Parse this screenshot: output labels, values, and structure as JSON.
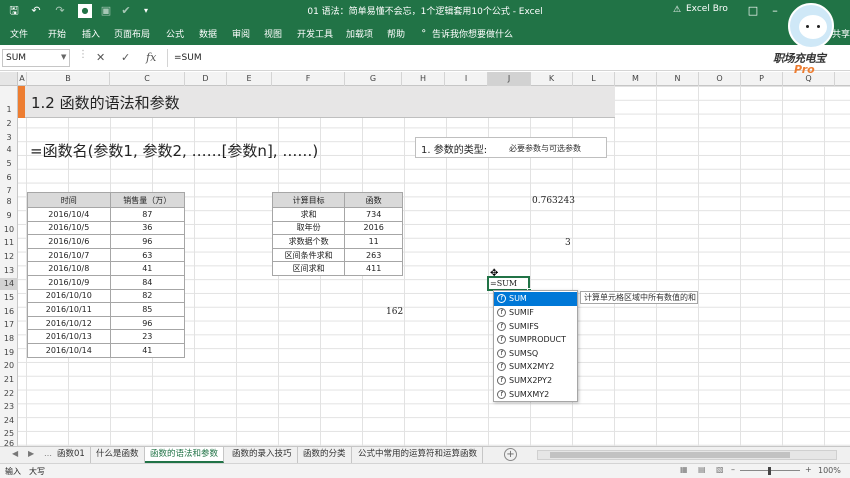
{
  "window": {
    "title": "01 语法：简单易懂不会忘，1个逻辑套用10个公式 - Excel",
    "user": "Excel Bro",
    "share": "共享"
  },
  "quick_access": {
    "save_icon": "save-icon",
    "undo_icon": "undo-icon",
    "redo_icon": "redo-icon"
  },
  "ribbon": {
    "tabs": [
      "文件",
      "开始",
      "插入",
      "页面布局",
      "公式",
      "数据",
      "审阅",
      "视图",
      "开发工具",
      "加载项",
      "帮助"
    ],
    "tell_me": "告诉我你想要做什么"
  },
  "formula_bar": {
    "name_box": "SUM",
    "cancel": "✕",
    "enter": "✓",
    "fx": "fx",
    "value": "=SUM"
  },
  "columns": [
    "A",
    "B",
    "C",
    "D",
    "E",
    "F",
    "G",
    "H",
    "I",
    "J",
    "K",
    "L",
    "M",
    "N",
    "O",
    "P",
    "Q"
  ],
  "rows": [
    "1",
    "2",
    "3",
    "4",
    "5",
    "6",
    "7",
    "8",
    "9",
    "10",
    "11",
    "12",
    "13",
    "14",
    "15",
    "16",
    "17",
    "18",
    "19",
    "20",
    "21",
    "22",
    "23",
    "24",
    "25",
    "26"
  ],
  "sheet": {
    "banner_title": "1.2  函数的语法和参数",
    "syntax": "=函数名(参数1,  参数2,  ……[参数n],  ……)",
    "param_box_label": "1. 参数的类型:",
    "param_box_desc": "必要参数与可选参数",
    "sales_table": {
      "headers": [
        "时间",
        "销售量（万）"
      ],
      "rows": [
        [
          "2016/10/4",
          "87"
        ],
        [
          "2016/10/5",
          "36"
        ],
        [
          "2016/10/6",
          "96"
        ],
        [
          "2016/10/7",
          "63"
        ],
        [
          "2016/10/8",
          "41"
        ],
        [
          "2016/10/9",
          "84"
        ],
        [
          "2016/10/10",
          "82"
        ],
        [
          "2016/10/11",
          "85"
        ],
        [
          "2016/10/12",
          "96"
        ],
        [
          "2016/10/13",
          "23"
        ],
        [
          "2016/10/14",
          "41"
        ]
      ]
    },
    "calc_table": {
      "headers": [
        "计算目标",
        "函数"
      ],
      "rows": [
        [
          "求和",
          "734"
        ],
        [
          "取年份",
          "2016"
        ],
        [
          "求数据个数",
          "11"
        ],
        [
          "区间条件求和",
          "263"
        ],
        [
          "区间求和",
          "411"
        ]
      ]
    },
    "loose_values": {
      "j8": "0.763243",
      "j11": "3",
      "g15": "162"
    },
    "active_cell": "=SUM"
  },
  "autocomplete": {
    "items": [
      "SUM",
      "SUMIF",
      "SUMIFS",
      "SUMPRODUCT",
      "SUMSQ",
      "SUMX2MY2",
      "SUMX2PY2",
      "SUMXMY2"
    ],
    "selected_index": 0,
    "tooltip": "计算单元格区域中所有数值的和"
  },
  "sheet_tabs": {
    "tabs": [
      "函数01",
      "什么是函数",
      "函数的语法和参数",
      "函数的录入技巧",
      "函数的分类",
      "公式中常用的运算符和运算函数"
    ],
    "active_index": 2,
    "add": "+"
  },
  "status_bar": {
    "mode": "输入",
    "caps": "大写",
    "zoom": "100%"
  },
  "logo": {
    "line1": "职场充电宝",
    "line2": "Pro"
  }
}
